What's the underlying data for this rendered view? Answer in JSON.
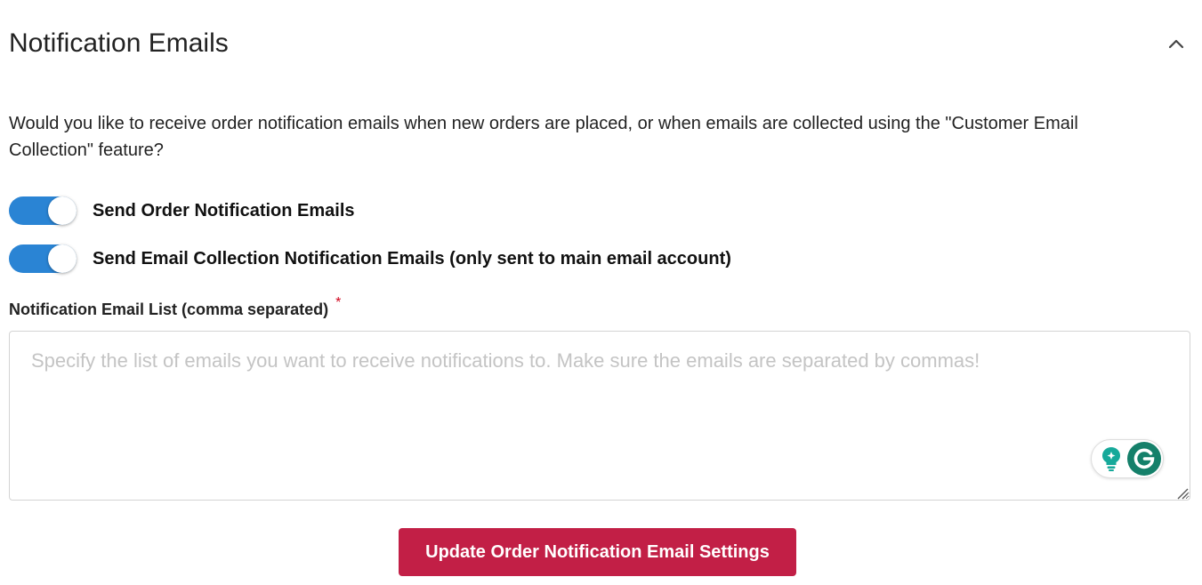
{
  "section": {
    "title": "Notification Emails",
    "collapse_icon": "chevron-up-icon"
  },
  "description": "Would you like to receive order notification emails when new orders are placed, or when emails are collected using the \"Customer Email Collection\" feature?",
  "toggles": [
    {
      "label": "Send Order Notification Emails",
      "checked": true
    },
    {
      "label": "Send Email Collection Notification Emails (only sent to main email account)",
      "checked": true
    }
  ],
  "email_list": {
    "label": "Notification Email List (comma separated)",
    "required_marker": "*",
    "value": "",
    "placeholder": "Specify the list of emails you want to receive notifications to. Make sure the emails are separated by commas!"
  },
  "grammarly_widget": {
    "icons": [
      "lightbulb-icon",
      "grammarly-logo-icon"
    ]
  },
  "submit_button": {
    "label": "Update Order Notification Email Settings"
  },
  "colors": {
    "toggle_on": "#2a84d4",
    "submit_bg": "#c21f46",
    "required": "#d0021b",
    "grammarly_green": "#15806a"
  }
}
